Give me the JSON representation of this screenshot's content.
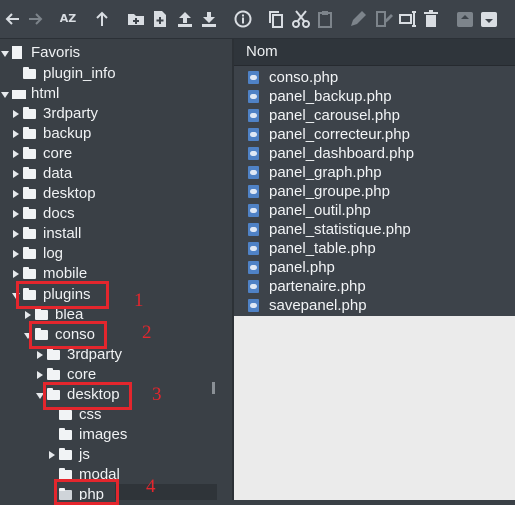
{
  "toolbar": {
    "icons": [
      "arrow-left-icon",
      "arrow-right-icon",
      "sort-az-icon",
      "arrow-up-icon",
      "new-folder-icon",
      "new-file-icon",
      "upload-icon",
      "download-icon",
      "info-icon",
      "copy-icon",
      "cut-icon",
      "paste-icon",
      "edit-icon",
      "rename-icon",
      "delete-icon",
      "archive-icon",
      "extract-icon"
    ],
    "sort_label": "AZ"
  },
  "tree": {
    "items": [
      {
        "label": "Favoris"
      },
      {
        "label": "plugin_info"
      },
      {
        "label": "html"
      },
      {
        "label": "3rdparty"
      },
      {
        "label": "backup"
      },
      {
        "label": "core"
      },
      {
        "label": "data"
      },
      {
        "label": "desktop"
      },
      {
        "label": "docs"
      },
      {
        "label": "install"
      },
      {
        "label": "log"
      },
      {
        "label": "mobile"
      },
      {
        "label": "plugins"
      },
      {
        "label": "blea"
      },
      {
        "label": "conso"
      },
      {
        "label": "3rdparty"
      },
      {
        "label": "core"
      },
      {
        "label": "desktop"
      },
      {
        "label": "css"
      },
      {
        "label": "images"
      },
      {
        "label": "js"
      },
      {
        "label": "modal"
      },
      {
        "label": "php"
      }
    ]
  },
  "annotations": [
    "1",
    "2",
    "3",
    "4"
  ],
  "annotation_color": "#e4262d",
  "files": {
    "header": "Nom",
    "items": [
      "conso.php",
      "panel_backup.php",
      "panel_carousel.php",
      "panel_correcteur.php",
      "panel_dashboard.php",
      "panel_graph.php",
      "panel_groupe.php",
      "panel_outil.php",
      "panel_statistique.php",
      "panel_table.php",
      "panel.php",
      "partenaire.php",
      "savepanel.php"
    ]
  }
}
